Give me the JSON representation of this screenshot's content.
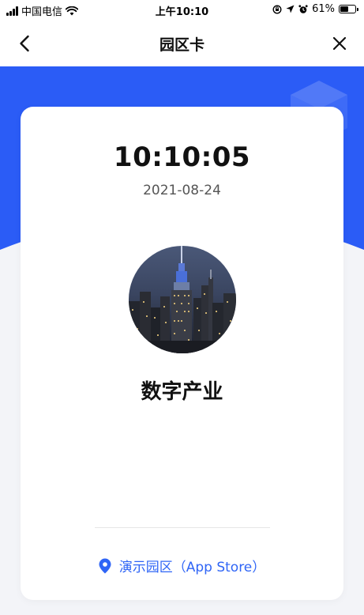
{
  "status_bar": {
    "carrier": "中国电信",
    "time": "上午10:10",
    "battery_percent": "61%",
    "battery_level": 0.61,
    "icons": [
      "signal-icon",
      "wifi-icon",
      "lock-rotation-icon",
      "location-arrow-icon",
      "alarm-icon",
      "battery-icon"
    ]
  },
  "nav": {
    "title": "园区卡",
    "back_icon": "chevron-left-icon",
    "close_icon": "close-icon"
  },
  "colors": {
    "brand_blue": "#2b5cf6",
    "link_blue": "#2f65f6",
    "page_bg": "#f3f4f8"
  },
  "card": {
    "time": "10:10:05",
    "date": "2021-08-24",
    "avatar": "city-skyline-photo",
    "organization": "数字产业",
    "location_icon": "map-pin-icon",
    "location_label": "演示园区（App Store）"
  }
}
